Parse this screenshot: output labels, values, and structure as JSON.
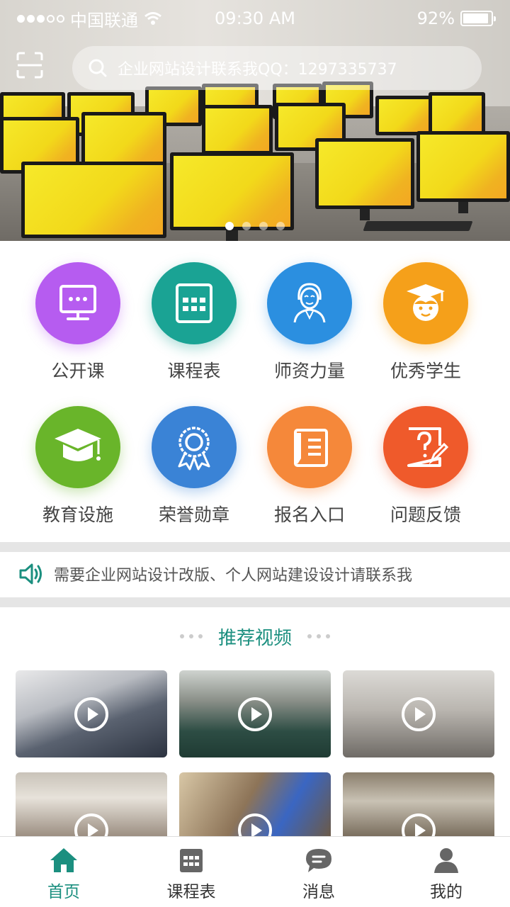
{
  "status_bar": {
    "carrier": "中国联通",
    "time": "09:30 AM",
    "battery": "92%",
    "battery_level": 0.92
  },
  "search": {
    "placeholder": "企业网站设计联系我QQ：1297335737"
  },
  "banner": {
    "page_count": 4,
    "active_page": 1
  },
  "categories": [
    {
      "label": "公开课",
      "icon": "screen-chat-icon",
      "color": "#b65cf0"
    },
    {
      "label": "课程表",
      "icon": "calendar-grid-icon",
      "color": "#1aa394"
    },
    {
      "label": "师资力量",
      "icon": "teacher-icon",
      "color": "#2b8fe0"
    },
    {
      "label": "优秀学生",
      "icon": "graduate-student-icon",
      "color": "#f5a01a"
    },
    {
      "label": "教育设施",
      "icon": "mortarboard-icon",
      "color": "#69b52a"
    },
    {
      "label": "荣誉勋章",
      "icon": "medal-icon",
      "color": "#3a83d6"
    },
    {
      "label": "报名入口",
      "icon": "register-form-icon",
      "color": "#f5883a"
    },
    {
      "label": "问题反馈",
      "icon": "feedback-question-icon",
      "color": "#ef5a2b"
    }
  ],
  "notice": {
    "text": "需要企业网站设计改版、个人网站建设设计请联系我"
  },
  "recommended": {
    "title": "推荐视频",
    "videos": [
      {
        "scene": "computer-lab"
      },
      {
        "scene": "classroom-desks"
      },
      {
        "scene": "desk-mug"
      },
      {
        "scene": "students-headscarves"
      },
      {
        "scene": "teacher-class"
      },
      {
        "scene": "workshop-room"
      }
    ]
  },
  "tabbar": {
    "items": [
      {
        "label": "首页",
        "icon": "home-icon",
        "active": true
      },
      {
        "label": "课程表",
        "icon": "calendar-grid-icon",
        "active": false
      },
      {
        "label": "消息",
        "icon": "message-bubble-icon",
        "active": false
      },
      {
        "label": "我的",
        "icon": "user-icon",
        "active": false
      }
    ],
    "accent": "#1b8f7f"
  }
}
